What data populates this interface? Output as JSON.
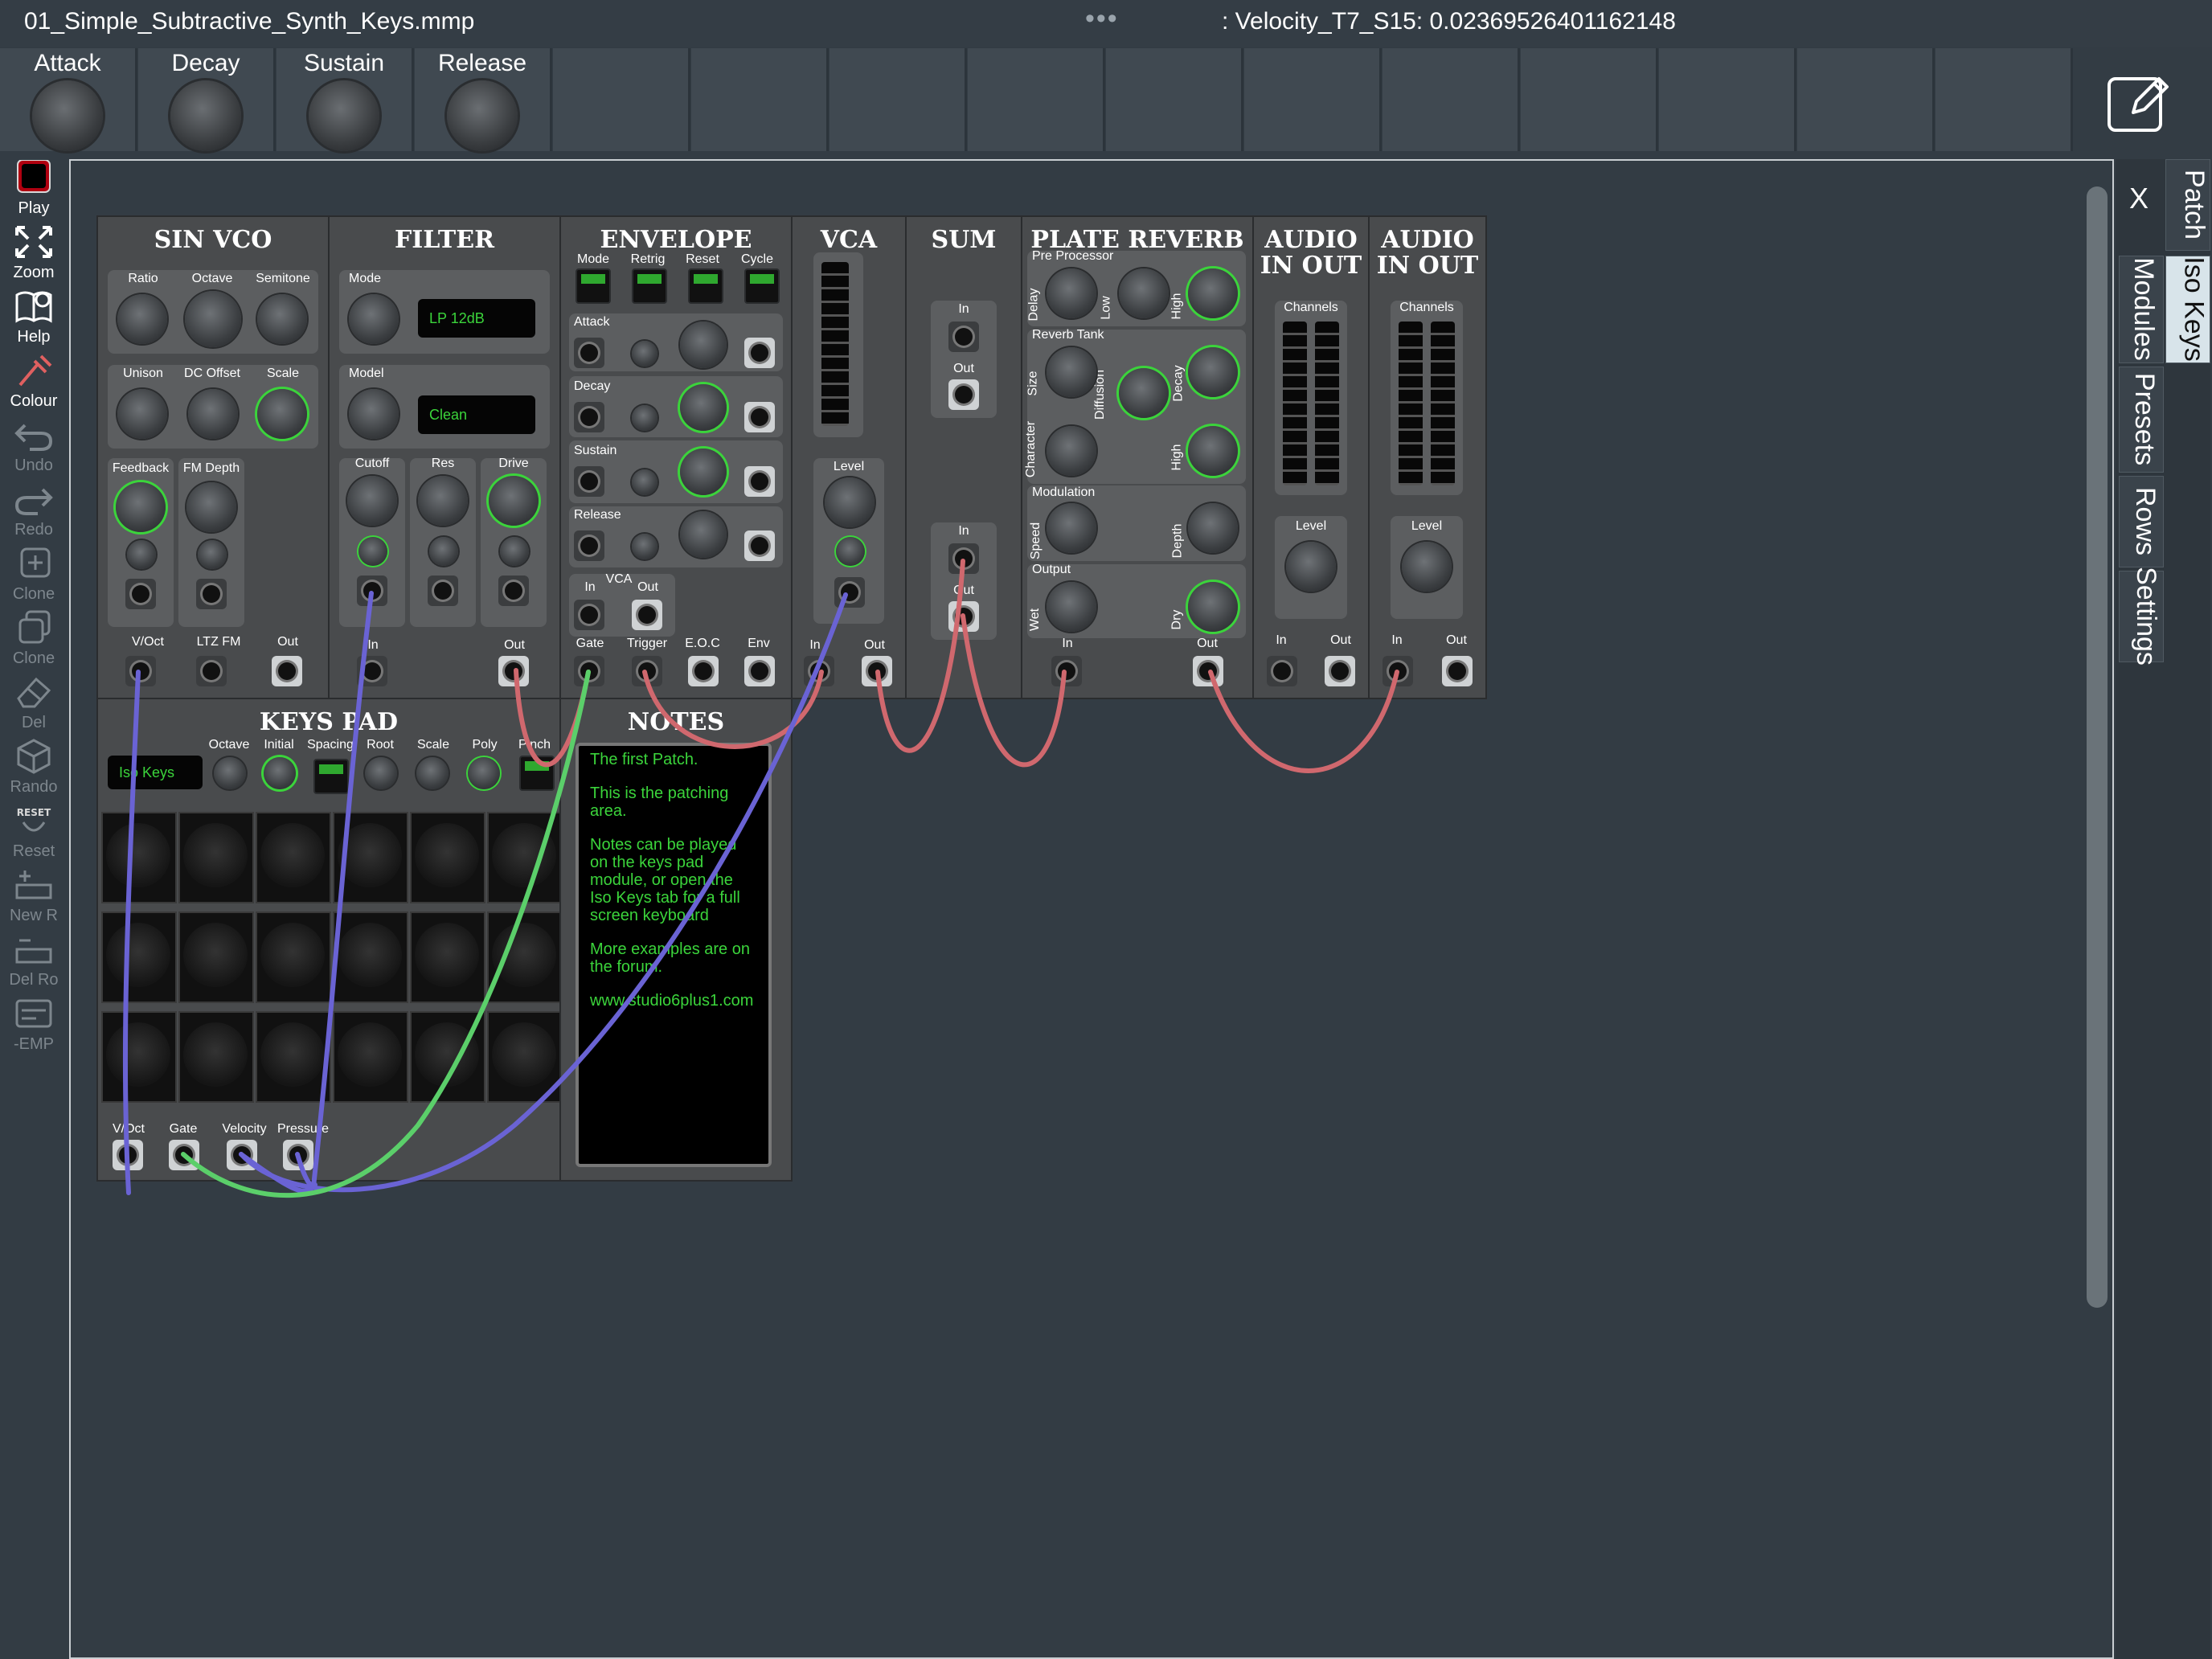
{
  "window": {
    "filename": "01_Simple_Subtractive_Synth_Keys.mmp",
    "status_text": ": Velocity_T7_S15: 0.02369526401162148"
  },
  "macros": [
    {
      "label": "Attack"
    },
    {
      "label": "Decay"
    },
    {
      "label": "Sustain"
    },
    {
      "label": "Release"
    }
  ],
  "sidebar": [
    {
      "label": "Play",
      "icon": "stop-square-icon",
      "enabled": true
    },
    {
      "label": "Zoom",
      "icon": "expand-arrows-icon",
      "enabled": true
    },
    {
      "label": "Help",
      "icon": "help-book-icon",
      "enabled": true
    },
    {
      "label": "Colour",
      "icon": "cable-colour-icon",
      "enabled": true
    },
    {
      "label": "Undo",
      "icon": "undo-arrow-icon",
      "enabled": false
    },
    {
      "label": "Redo",
      "icon": "redo-arrow-icon",
      "enabled": false
    },
    {
      "label": "Clone",
      "icon": "clone-plus-icon",
      "enabled": false
    },
    {
      "label": "Clone",
      "icon": "clone-copy-icon",
      "enabled": false
    },
    {
      "label": "Del",
      "icon": "eraser-icon",
      "enabled": false
    },
    {
      "label": "Rando",
      "icon": "dice-icon",
      "enabled": false
    },
    {
      "label": "Reset",
      "icon": "reset-icon",
      "enabled": false
    },
    {
      "label": "New R",
      "icon": "new-row-icon",
      "enabled": false
    },
    {
      "label": "Del Ro",
      "icon": "delete-row-icon",
      "enabled": false
    },
    {
      "label": "-EMP",
      "icon": "module-icon",
      "enabled": false
    }
  ],
  "right_tabs": {
    "close": "X",
    "tabs": [
      "Patch",
      "Iso Keys",
      "Modules",
      "Presets",
      "Rows",
      "Settings"
    ]
  },
  "modules": {
    "sin_vco": {
      "title": "SIN VCO",
      "labels": [
        "Ratio",
        "Octave",
        "Semitone",
        "Unison",
        "DC Offset",
        "Scale",
        "Feedback",
        "FM Depth",
        "V/Oct",
        "LTZ FM",
        "Out"
      ]
    },
    "filter": {
      "title": "FILTER",
      "mode_label": "Mode",
      "mode_value": "LP 12dB",
      "model_label": "Model",
      "model_value": "Clean",
      "labels": [
        "Cutoff",
        "Res",
        "Drive",
        "In",
        "Out"
      ]
    },
    "envelope": {
      "title": "ENVELOPE",
      "buttons": [
        "Mode",
        "Retrig",
        "Reset",
        "Cycle"
      ],
      "stages": [
        "Attack",
        "Decay",
        "Sustain",
        "Release"
      ],
      "vca": "VCA",
      "vca_in": "In",
      "vca_out": "Out",
      "jacks": [
        "Gate",
        "Trigger",
        "E.O.C",
        "Env"
      ]
    },
    "vca": {
      "title": "VCA",
      "level": "Level",
      "in": "In",
      "out": "Out"
    },
    "sum": {
      "title": "SUM",
      "in1": "In",
      "out1": "Out",
      "in2": "In",
      "out2": "Out"
    },
    "plate_reverb": {
      "title": "PLATE REVERB",
      "sections": [
        "Pre Processor",
        "Reverb Tank",
        "Modulation",
        "Output"
      ],
      "knob_labels": [
        "Delay",
        "Low",
        "High",
        "Size",
        "Diffusion",
        "Decay",
        "Character",
        "High",
        "Speed",
        "Depth",
        "Wet",
        "Dry"
      ],
      "in": "In",
      "out": "Out"
    },
    "audio1": {
      "title_line1": "AUDIO",
      "title_line2": "IN OUT",
      "channels": "Channels",
      "level": "Level",
      "in": "In",
      "out": "Out"
    },
    "audio2": {
      "title_line1": "AUDIO",
      "title_line2": "IN OUT",
      "channels": "Channels",
      "level": "Level",
      "in": "In",
      "out": "Out"
    },
    "keys_pad": {
      "title": "KEYS PAD",
      "display": "Iso Keys",
      "labels": [
        "Octave",
        "Initial",
        "Spacing",
        "Root",
        "Scale",
        "Poly",
        "Pinch"
      ],
      "jacks": [
        "V/Oct",
        "Gate",
        "Velocity",
        "Pressure"
      ]
    },
    "notes": {
      "title": "NOTES",
      "paragraphs": [
        "The first Patch.",
        "This is the patching area.",
        "Notes can be played on the keys pad module, or open the Iso Keys tab for a full screen keyboard",
        "More examples are on the forum.",
        "www.studio6plus1.com"
      ]
    }
  },
  "colors": {
    "cable_red": "#d0686e",
    "cable_blue": "#6a63d4",
    "cable_green": "#5bcf6a",
    "led_green": "#3bd43b",
    "background": "#333c44"
  }
}
